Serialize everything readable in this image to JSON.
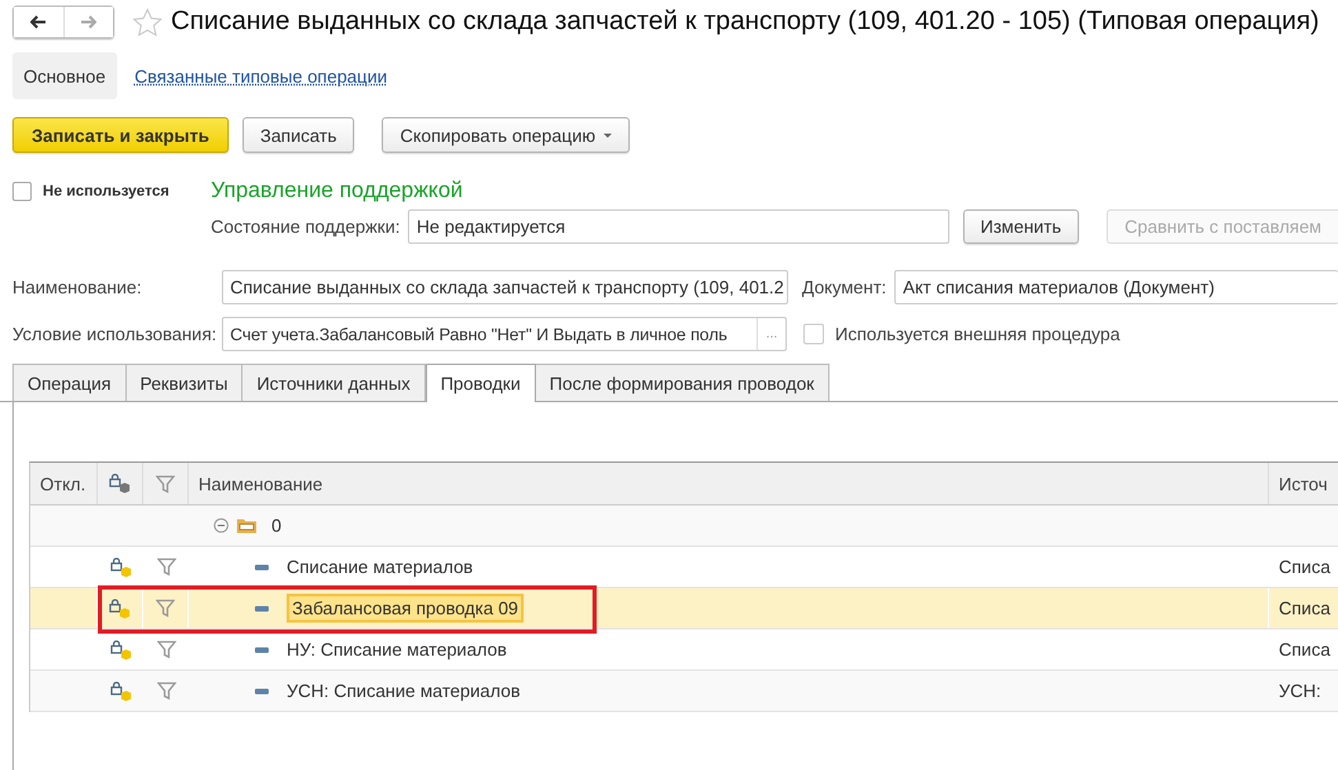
{
  "title": "Списание выданных со склада запчастей к транспорту (109, 401.20 - 105) (Типовая операция)",
  "sections": [
    {
      "label": "Основное",
      "selected": true
    },
    {
      "label": "Связанные типовые операции",
      "selected": false
    }
  ],
  "actions": [
    {
      "label": "Записать и закрыть",
      "kind": "primary"
    },
    {
      "label": "Записать",
      "kind": "plain"
    },
    {
      "label": "Скопировать операцию",
      "kind": "menu"
    }
  ],
  "not_used": {
    "label": "Не используется",
    "checked": false
  },
  "support": {
    "title": "Управление поддержкой",
    "state_label": "Состояние поддержки:",
    "state_value": "Не редактируется",
    "buttons": [
      {
        "label": "Изменить",
        "disabled": false
      },
      {
        "label": "Сравнить с поставляем",
        "disabled": true
      }
    ]
  },
  "fields": {
    "name": {
      "label": "Наименование:",
      "value": "Списание выданных со склада запчастей к транспорту (109, 401.2"
    },
    "document": {
      "label": "Документ:",
      "value": "Акт списания материалов (Документ)"
    },
    "condition": {
      "label": "Условие использования:",
      "value": "Счет учета.Забалансовый Равно \"Нет\" И Выдать в личное поль",
      "button": "..."
    }
  },
  "external_procedure": {
    "label": "Используется внешняя процедура",
    "checked": false
  },
  "tabs": [
    {
      "label": "Операция",
      "selected": false
    },
    {
      "label": "Реквизиты",
      "selected": false
    },
    {
      "label": "Источники данных",
      "selected": false
    },
    {
      "label": "Проводки",
      "selected": true
    },
    {
      "label": "После формирования проводок",
      "selected": false
    }
  ],
  "table": {
    "columns": [
      {
        "kind": "text",
        "label": "Откл."
      },
      {
        "kind": "lock"
      },
      {
        "kind": "filter"
      },
      {
        "kind": "text",
        "label": "Наименование"
      },
      {
        "kind": "text",
        "label": "Источ"
      }
    ],
    "rows": [
      {
        "name": "0",
        "expanded": true,
        "children": [
          {
            "name": "Списание материалов",
            "source": "Списа",
            "selected": false,
            "annotated": false
          },
          {
            "name": "Забалансовая проводка 09",
            "source": "Списа",
            "selected": true,
            "annotated": true
          },
          {
            "name": "НУ: Списание материалов",
            "source": "Списа",
            "selected": false,
            "annotated": false
          },
          {
            "name": "УСН: Списание материалов",
            "source": "УСН:",
            "selected": false,
            "annotated": false
          }
        ]
      }
    ]
  }
}
